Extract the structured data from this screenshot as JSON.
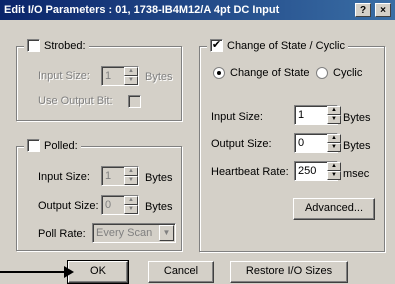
{
  "window": {
    "title": "Edit I/O Parameters : 01, 1738-IB4M12/A 4pt DC Input",
    "help_label": "?",
    "close_label": "×"
  },
  "strobed": {
    "label": "Strobed:",
    "checked": false,
    "input_size_label": "Input Size:",
    "input_size_value": "1",
    "input_size_unit": "Bytes",
    "use_output_bit_label": "Use Output Bit:"
  },
  "polled": {
    "label": "Polled:",
    "checked": false,
    "input_size_label": "Input Size:",
    "input_size_value": "1",
    "input_size_unit": "Bytes",
    "output_size_label": "Output Size:",
    "output_size_value": "0",
    "output_size_unit": "Bytes",
    "poll_rate_label": "Poll Rate:",
    "poll_rate_value": "Every Scan"
  },
  "cos": {
    "label": "Change of State / Cyclic",
    "checked": true,
    "check_mark": "✔",
    "mode_cos_label": "Change of State",
    "mode_cyclic_label": "Cyclic",
    "selected_mode": "Change of State",
    "input_size_label": "Input Size:",
    "input_size_value": "1",
    "input_size_unit": "Bytes",
    "output_size_label": "Output Size:",
    "output_size_value": "0",
    "output_size_unit": "Bytes",
    "heartbeat_label": "Heartbeat Rate:",
    "heartbeat_value": "250",
    "heartbeat_unit": "msec",
    "advanced_label": "Advanced..."
  },
  "footer": {
    "ok_label": "OK",
    "cancel_label": "Cancel",
    "restore_label": "Restore I/O Sizes"
  }
}
